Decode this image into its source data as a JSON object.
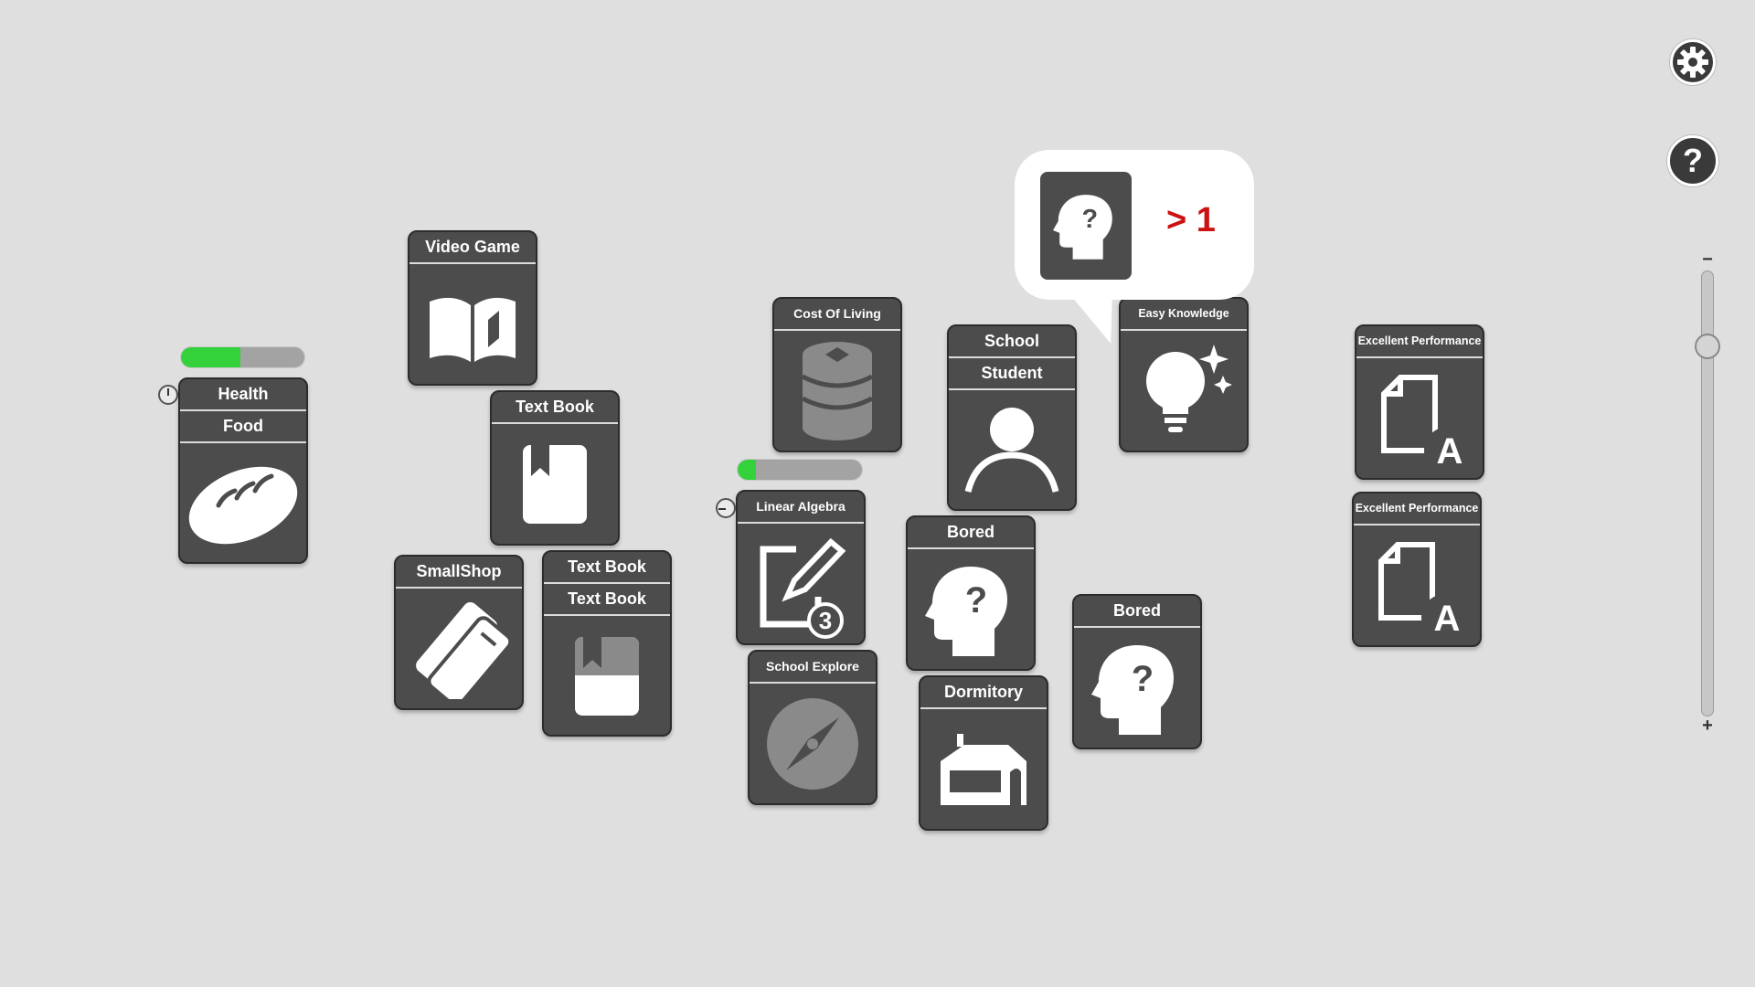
{
  "cards": {
    "health_food": {
      "title1": "Health",
      "title2": "Food"
    },
    "video_game": {
      "title": "Video Game"
    },
    "text_book": {
      "title": "Text Book"
    },
    "smallshop": {
      "title": "SmallShop"
    },
    "text_book_stack": {
      "title1": "Text Book",
      "title2": "Text Book"
    },
    "cost_of_living": {
      "title": "Cost Of Living"
    },
    "linear_algebra": {
      "title": "Linear Algebra",
      "badge": "3"
    },
    "school_explore": {
      "title": "School Explore"
    },
    "school_student": {
      "title1": "School",
      "title2": "Student"
    },
    "bored_1": {
      "title": "Bored"
    },
    "bored_2": {
      "title": "Bored"
    },
    "dormitory": {
      "title": "Dormitory"
    },
    "easy_knowledge": {
      "title": "Easy Knowledge"
    },
    "excellent_performance_1": {
      "title": "Excellent Performance",
      "grade": "A"
    },
    "excellent_performance_2": {
      "title": "Excellent Performance",
      "grade": "A"
    }
  },
  "progress": {
    "health_food": 0.48,
    "linear_algebra": 0.15
  },
  "speech_bubble": {
    "text": "> 1",
    "icon": "head-question-icon"
  },
  "controls": {
    "settings_icon": "gear-icon",
    "help_label": "?",
    "zoom_minus": "−",
    "zoom_plus": "+",
    "zoom_level": 0.15
  },
  "colors": {
    "background": "#dfdfdf",
    "card": "#4c4c4c",
    "progress_fill": "#33d13a",
    "bubble_text": "#cc1111"
  }
}
